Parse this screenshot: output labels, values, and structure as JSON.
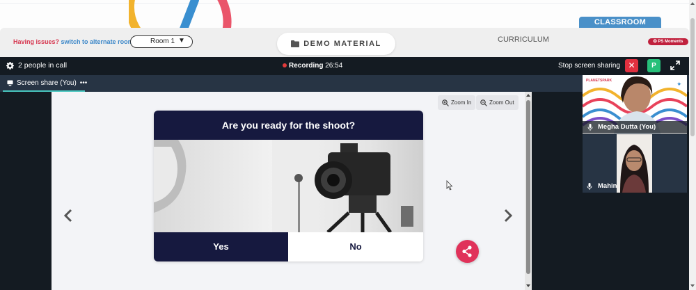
{
  "header": {
    "issues_text": "Having issues?",
    "switch_text": "switch to alternate room",
    "room_select": "Room 1",
    "demo_material": "DEMO MATERIAL",
    "curriculum": "CURRICULUM",
    "classroom_tab": "CLASSROOM",
    "ps_moments": "PS Moments"
  },
  "call": {
    "people_count": "2 people in call",
    "recording_label": "Recording",
    "recording_time": "26:54",
    "stop_sharing": "Stop screen sharing",
    "p_badge": "P"
  },
  "tabs": {
    "screen_share": "Screen share (You)"
  },
  "slide": {
    "zoom_in": "Zoom In",
    "zoom_out": "Zoom Out",
    "question": "Are you ready for the shoot?",
    "yes": "Yes",
    "no": "No"
  },
  "participants": [
    {
      "name": "Megha Dutta (You)",
      "logo_text": "PLANETSPARK"
    },
    {
      "name": "Mahin"
    }
  ],
  "colors": {
    "card_navy": "#16193f",
    "record_red": "#e23b3b",
    "share_fab": "#e0325a",
    "classroom_blue": "#4a90c8",
    "dark_bg": "#141b22"
  }
}
